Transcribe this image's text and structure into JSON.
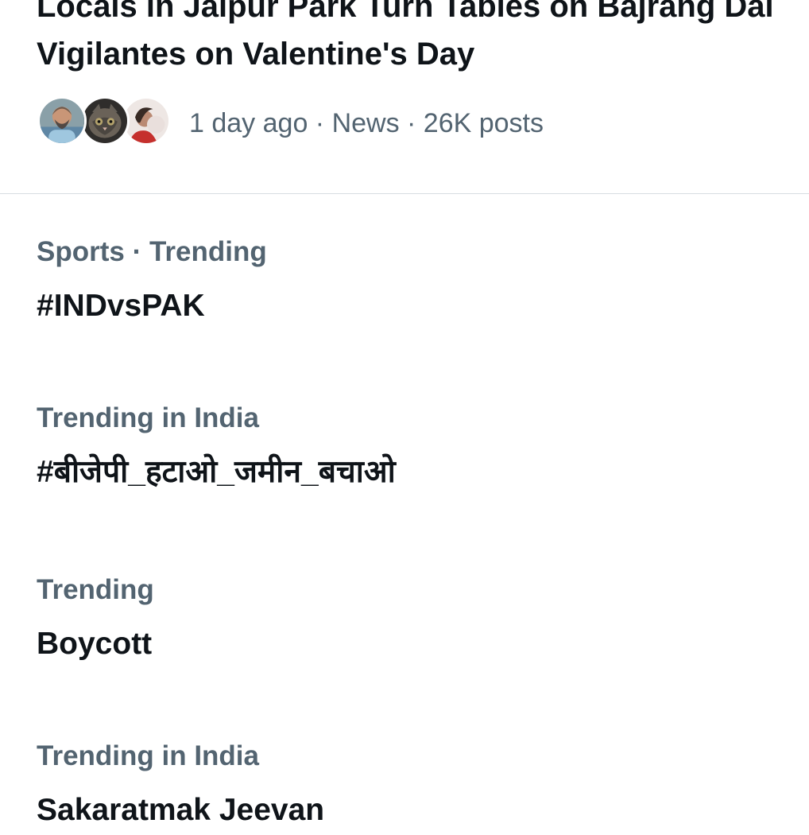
{
  "news": {
    "title_line_1": "Locals in Jaipur Park Turn Tables on Bajrang Dal",
    "title_line_2": "Vigilantes on Valentine's Day",
    "meta": "1 day ago · News · 26K posts",
    "avatars": [
      "avatar-person-icon",
      "avatar-cat-icon",
      "avatar-woman-icon"
    ]
  },
  "trends": [
    {
      "context": "Sports · Trending",
      "name": "#INDvsPAK"
    },
    {
      "context": "Trending in India",
      "name": "#बीजेपी_हटाओ_जमीन_बचाओ"
    },
    {
      "context": "Trending",
      "name": "Boycott"
    },
    {
      "context": "Trending in India",
      "name": "Sakaratmak Jeevan"
    }
  ],
  "colors": {
    "text_primary": "#0f1419",
    "text_secondary": "#536471",
    "divider": "#d7dde2",
    "background": "#ffffff"
  }
}
